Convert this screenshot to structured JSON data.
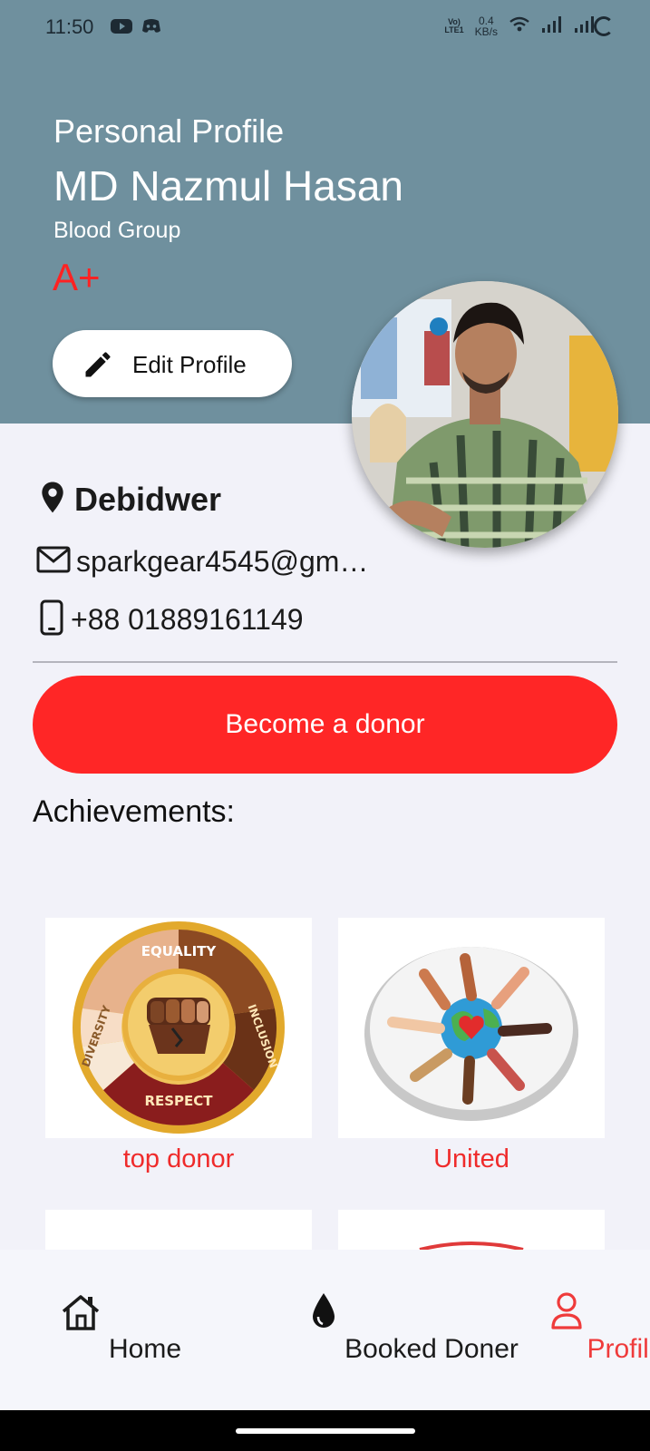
{
  "status_bar": {
    "time": "11:50",
    "volte_top": "Vo)",
    "volte_bottom": "LTE1",
    "speed_value": "0.4",
    "speed_unit": "KB/s",
    "app_icons": [
      "youtube-icon",
      "discord-icon"
    ],
    "right_icons": [
      "wifi-icon",
      "signal-icon",
      "signal-icon",
      "loading-ring-icon"
    ]
  },
  "header": {
    "section_title": "Personal Profile",
    "name": "MD Nazmul Hasan",
    "blood_group_label": "Blood Group",
    "blood_group_value": "A+",
    "edit_button": "Edit Profile",
    "background_color": "#6f909e",
    "accent_red": "#ff2222"
  },
  "contact": {
    "location": "Debidwer",
    "email": "sparkgear4545@gm…",
    "phone": "+88 01889161149"
  },
  "donor_button": "Become a donor",
  "achievements": {
    "title": "Achievements:",
    "items": [
      {
        "label": "top donor",
        "image": "diversity-badge"
      },
      {
        "label": "United",
        "image": "united-hands-badge"
      },
      {
        "label": "",
        "image": "blank-badge"
      },
      {
        "label": "",
        "image": "red-badge"
      }
    ],
    "badge_words": [
      "EQUALITY",
      "INCLUSION",
      "RESPECT",
      "DIVERSITY"
    ]
  },
  "bottom_nav": {
    "items": [
      {
        "label": "Home",
        "icon": "home-icon",
        "active": false
      },
      {
        "label": "Booked Doner",
        "icon": "blood-drop-icon",
        "active": false
      },
      {
        "label": "Profile",
        "icon": "person-icon",
        "active": true
      }
    ],
    "active_color": "#ef3b3b"
  }
}
